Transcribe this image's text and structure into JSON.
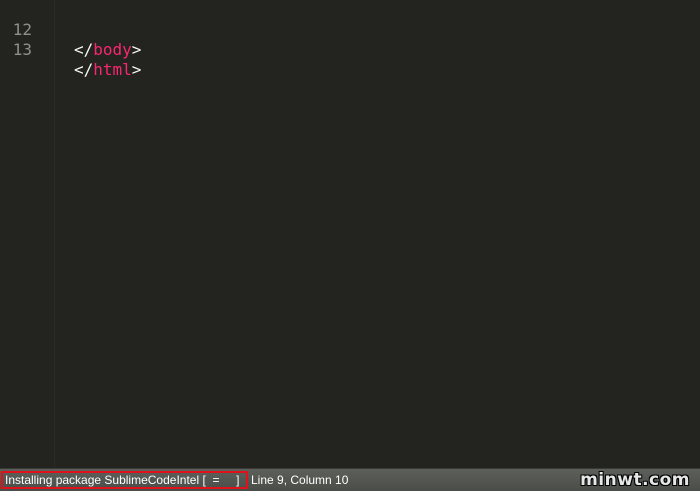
{
  "editor": {
    "lines": [
      {
        "number": "12",
        "open": "</",
        "tag": "body",
        "close": ">"
      },
      {
        "number": "13",
        "open": "</",
        "tag": "html",
        "close": ">"
      }
    ]
  },
  "statusbar": {
    "message": "Installing package SublimeCodeIntel [  =     ]",
    "position": "Line 9, Column 10"
  },
  "watermark": "minwt.com",
  "colors": {
    "background": "#23241f",
    "tag": "#f92672",
    "highlight_box": "#e0111b"
  }
}
